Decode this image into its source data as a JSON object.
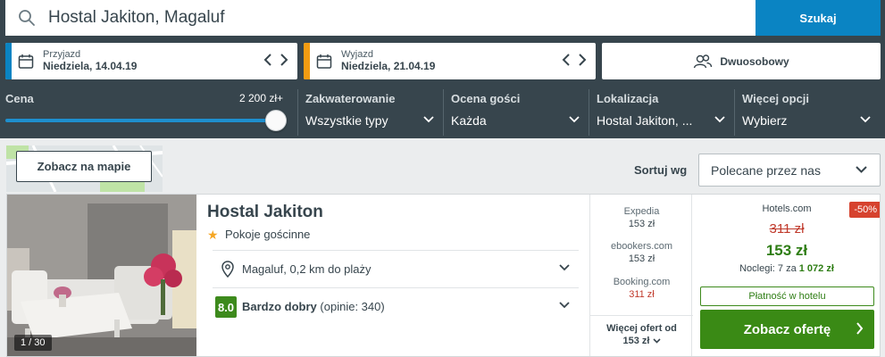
{
  "search": {
    "value": "Hostal Jakiton, Magaluf",
    "button_label": "Szukaj"
  },
  "dates": {
    "checkin": {
      "label": "Przyjazd",
      "value": "Niedziela, 14.04.19",
      "accent": "#0a84c3"
    },
    "checkout": {
      "label": "Wyjazd",
      "value": "Niedziela, 21.04.19",
      "accent": "#f39c12"
    }
  },
  "room": {
    "label": "Dwuosobowy"
  },
  "filters": {
    "price": {
      "title": "Cena",
      "max": "2 200 zł+",
      "slider_fraction": 1.0
    },
    "accommodation": {
      "title": "Zakwaterowanie",
      "value": "Wszystkie typy"
    },
    "guest_rating": {
      "title": "Ocena gości",
      "value": "Każda"
    },
    "location": {
      "title": "Lokalizacja",
      "value": "Hostal Jakiton, ..."
    },
    "more": {
      "title": "Więcej opcji",
      "value": "Wybierz"
    }
  },
  "map": {
    "button_label": "Zobacz na mapie"
  },
  "sort": {
    "label": "Sortuj wg",
    "value": "Polecane przez nas"
  },
  "result": {
    "photo_counter": "1 / 30",
    "name": "Hostal Jakiton",
    "stars": 1,
    "type": "Pokoje gościnne",
    "location_text": "Magaluf, 0,2 km do plaży",
    "rating_score": "8.0",
    "rating_label": "Bardzo dobry",
    "rating_count": "(opinie: 340)",
    "offers": [
      {
        "provider": "Expedia",
        "price": "153 zł"
      },
      {
        "provider": "ebookers.com",
        "price": "153 zł"
      },
      {
        "provider": "Booking.com",
        "price": "311 zł"
      }
    ],
    "more_offers_label": "Więcej ofert od",
    "more_offers_price": "153 zł",
    "best": {
      "provider": "Hotels.com",
      "discount": "-50%",
      "old_price": "311 zł",
      "new_price": "153 zł",
      "nights_prefix": "Noclegi: 7 za",
      "nights_total": "1 072 zł",
      "pay_at_hotel": "Płatność w hotelu",
      "cta_label": "Zobacz ofertę"
    }
  }
}
